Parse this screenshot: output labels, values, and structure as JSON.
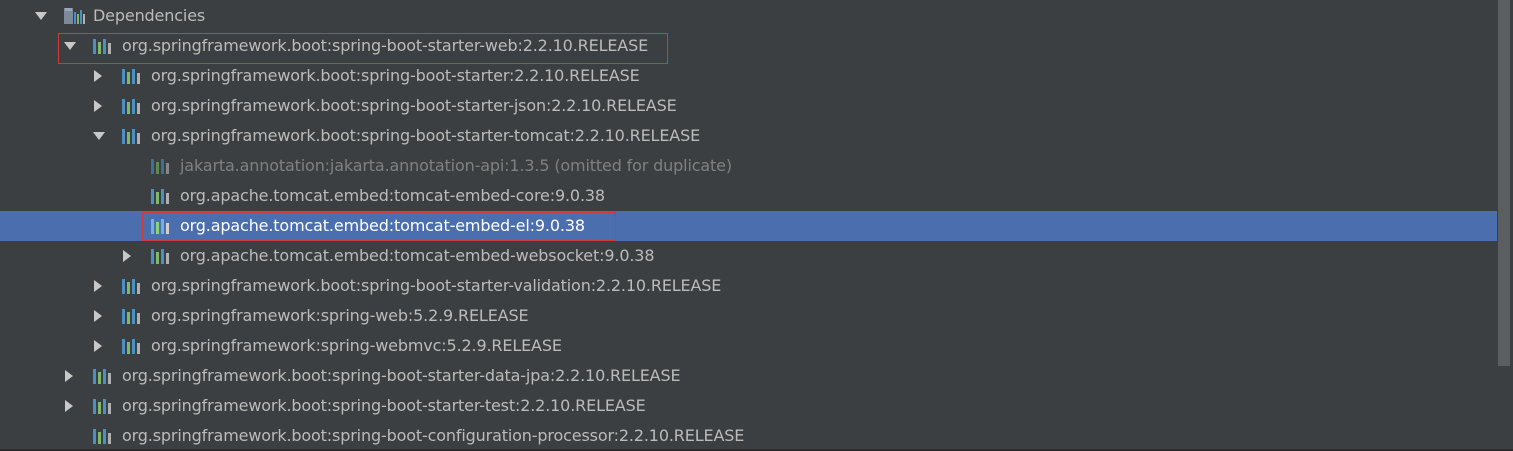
{
  "tree": {
    "rows": [
      {
        "label": "Dependencies",
        "expanded": true,
        "icon": "folder-library-icon"
      },
      {
        "label": "org.springframework.boot:spring-boot-starter-web:2.2.10.RELEASE",
        "expanded": true,
        "icon": "library-icon"
      },
      {
        "label": "org.springframework.boot:spring-boot-starter:2.2.10.RELEASE",
        "expanded": false,
        "icon": "library-icon"
      },
      {
        "label": "org.springframework.boot:spring-boot-starter-json:2.2.10.RELEASE",
        "expanded": false,
        "icon": "library-icon"
      },
      {
        "label": "org.springframework.boot:spring-boot-starter-tomcat:2.2.10.RELEASE",
        "expanded": true,
        "icon": "library-icon"
      },
      {
        "label": "jakarta.annotation:jakarta.annotation-api:1.3.5 (omitted for duplicate)",
        "icon": "library-icon",
        "dimmed": true
      },
      {
        "label": "org.apache.tomcat.embed:tomcat-embed-core:9.0.38",
        "icon": "library-icon"
      },
      {
        "label": "org.apache.tomcat.embed:tomcat-embed-el:9.0.38",
        "icon": "library-icon",
        "selected": true
      },
      {
        "label": "org.apache.tomcat.embed:tomcat-embed-websocket:9.0.38",
        "expanded": false,
        "icon": "library-icon"
      },
      {
        "label": "org.springframework.boot:spring-boot-starter-validation:2.2.10.RELEASE",
        "expanded": false,
        "icon": "library-icon"
      },
      {
        "label": "org.springframework:spring-web:5.2.9.RELEASE",
        "expanded": false,
        "icon": "library-icon"
      },
      {
        "label": "org.springframework:spring-webmvc:5.2.9.RELEASE",
        "expanded": false,
        "icon": "library-icon"
      },
      {
        "label": "org.springframework.boot:spring-boot-starter-data-jpa:2.2.10.RELEASE",
        "expanded": false,
        "icon": "library-icon"
      },
      {
        "label": "org.springframework.boot:spring-boot-starter-test:2.2.10.RELEASE",
        "expanded": false,
        "icon": "library-icon"
      },
      {
        "label": "org.springframework.boot:spring-boot-configuration-processor:2.2.10.RELEASE",
        "icon": "library-icon"
      }
    ]
  },
  "colors": {
    "background": "#3c3f41",
    "selection": "#4b6eaf",
    "text": "#bbbbbb",
    "dimmed_text": "#808080",
    "highlight_border": "#d13a3a"
  }
}
